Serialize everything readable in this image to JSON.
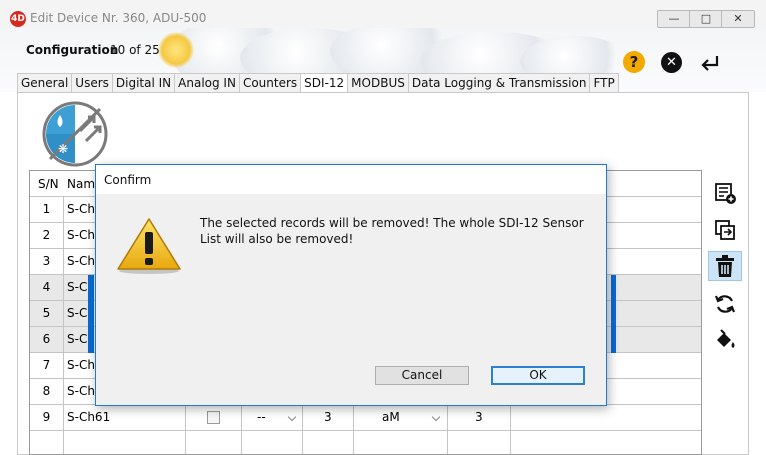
{
  "window": {
    "title": "Edit Device Nr. 360, ADU-500"
  },
  "header": {
    "config_label": "Configuration",
    "config_count": "10 of 25"
  },
  "tabs": [
    {
      "label": "General"
    },
    {
      "label": "Users"
    },
    {
      "label": "Digital IN"
    },
    {
      "label": "Analog IN"
    },
    {
      "label": "Counters"
    },
    {
      "label": "SDI-12",
      "active": true
    },
    {
      "label": "MODBUS"
    },
    {
      "label": "Data Logging & Transmission"
    },
    {
      "label": "FTP"
    }
  ],
  "table": {
    "headers": {
      "sn": "S/N",
      "name": "Nam"
    },
    "rows": [
      {
        "sn": "1",
        "name": "S-Ch",
        "selected": false
      },
      {
        "sn": "2",
        "name": "S-Ch",
        "selected": false
      },
      {
        "sn": "3",
        "name": "S-Ch",
        "selected": false
      },
      {
        "sn": "4",
        "name": "S-Ch",
        "selected": true
      },
      {
        "sn": "5",
        "name": "S-Ch",
        "selected": true
      },
      {
        "sn": "6",
        "name": "S-Ch",
        "selected": true
      },
      {
        "sn": "7",
        "name": "S-Ch",
        "selected": false
      },
      {
        "sn": "8",
        "name": "S-Ch",
        "selected": false
      },
      {
        "sn": "9",
        "name": "S-Ch61",
        "selected": false,
        "col3": "--",
        "col4": "3",
        "col5": "aM",
        "col6": "3"
      }
    ]
  },
  "toolbar": [
    "add-list-icon",
    "copy-icon",
    "delete-icon",
    "refresh-icon",
    "fill-icon"
  ],
  "dialog": {
    "title": "Confirm",
    "message": "The selected records will be removed! The whole SDI-12 Sensor List will also be removed!",
    "cancel_label": "Cancel",
    "ok_label": "OK"
  },
  "colors": {
    "accent": "#1c7ad6",
    "selection": "#0a6ad0",
    "help": "#f2a900",
    "warning": "#f5c218"
  }
}
